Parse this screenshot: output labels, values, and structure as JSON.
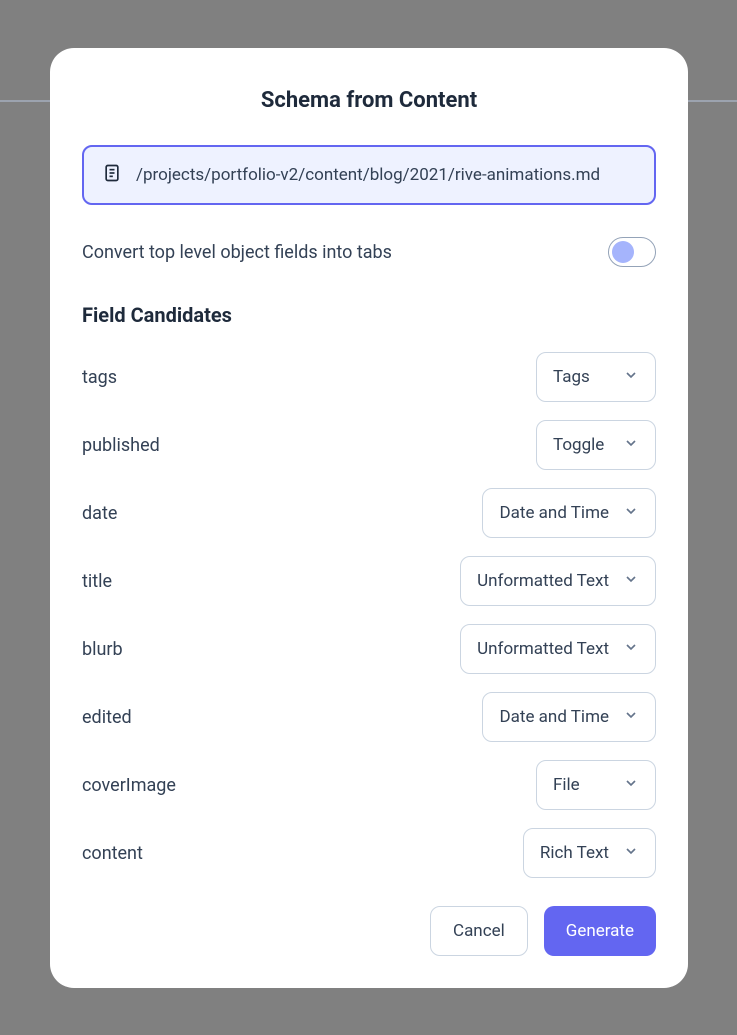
{
  "modal": {
    "title": "Schema from Content",
    "path": "/projects/portfolio-v2/content/blog/2021/rive-animations.md",
    "convertTabsLabel": "Convert top level object fields into tabs",
    "sectionTitle": "Field Candidates",
    "fields": [
      {
        "name": "tags",
        "type": "Tags"
      },
      {
        "name": "published",
        "type": "Toggle"
      },
      {
        "name": "date",
        "type": "Date and Time"
      },
      {
        "name": "title",
        "type": "Unformatted Text"
      },
      {
        "name": "blurb",
        "type": "Unformatted Text"
      },
      {
        "name": "edited",
        "type": "Date and Time"
      },
      {
        "name": "coverImage",
        "type": "File"
      },
      {
        "name": "content",
        "type": "Rich Text"
      }
    ],
    "actions": {
      "cancel": "Cancel",
      "generate": "Generate"
    }
  }
}
